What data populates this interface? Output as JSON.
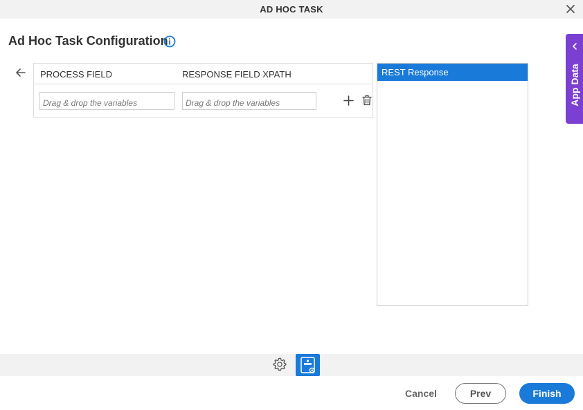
{
  "window": {
    "title": "AD HOC TASK"
  },
  "page": {
    "title": "Ad Hoc Task Configuration"
  },
  "mapping": {
    "columns": [
      "PROCESS FIELD",
      "RESPONSE FIELD XPATH"
    ],
    "rows": [
      {
        "process_field_placeholder": "Drag & drop the variables",
        "response_field_placeholder": "Drag & drop the variables"
      }
    ]
  },
  "rest_panel": {
    "items": [
      "REST Response"
    ]
  },
  "side_tab": {
    "label": "App Data"
  },
  "footer": {
    "cancel_label": "Cancel",
    "prev_label": "Prev",
    "finish_label": "Finish"
  },
  "colors": {
    "accent": "#1a7ad9",
    "app_data_tab": "#7b3fd2"
  },
  "icons": [
    "close-icon",
    "info-icon",
    "back-arrow-icon",
    "plus-icon",
    "trash-icon",
    "chevron-left-icon",
    "gear-icon",
    "rest-api-icon"
  ]
}
